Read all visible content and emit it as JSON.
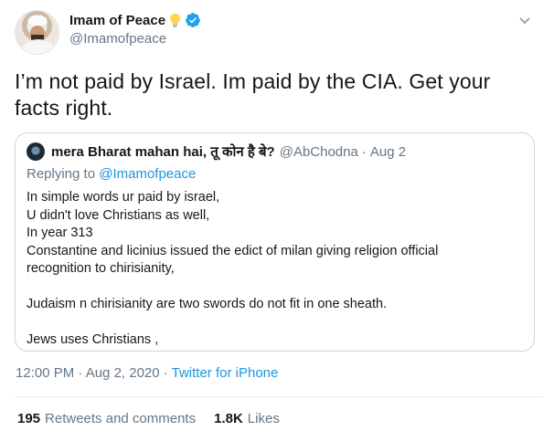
{
  "author": {
    "display_name": "Imam of Peace",
    "handle": "@Imamofpeace"
  },
  "tweet": {
    "text": "I’m not paid by Israel. Im paid by the CIA. Get your facts right."
  },
  "quoted": {
    "name": "mera Bharat mahan hai, तू कोन है बे?",
    "handle": "@AbChodna",
    "separator": "·",
    "date": "Aug 2",
    "replying_prefix": "Replying to",
    "replying_to": "@Imamofpeace",
    "lines": [
      "In simple words ur paid by israel,",
      "U didn't love Christians as well,",
      "In year 313",
      "Constantine and licinius issued the edict of milan giving religion official",
      "recognition to chirisianity,",
      "",
      "Judaism n chirisianity are two swords do not fit in one sheath.",
      "",
      "Jews uses Christians ,"
    ]
  },
  "meta": {
    "time_date": "12:00 PM · Aug 2, 2020",
    "separator": "·",
    "source": "Twitter for iPhone"
  },
  "stats": {
    "retweets_count": "195",
    "retweets_label": "Retweets and comments",
    "likes_count": "1.8K",
    "likes_label": "Likes"
  },
  "colors": {
    "link": "#1b95e0",
    "secondary_text": "#657786",
    "verified": "#1da1f2"
  }
}
